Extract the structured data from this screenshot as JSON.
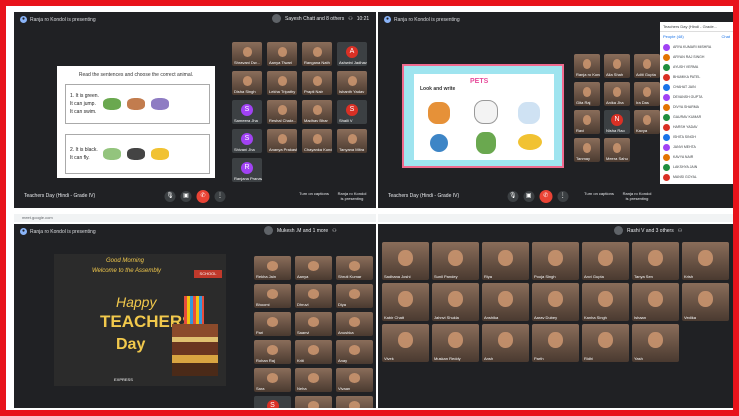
{
  "q1": {
    "presenting": "Ranja ro Kondol is presenting",
    "top_right": {
      "name": "Sayesh Chatt and 8 others",
      "time": "10:21"
    },
    "slide": {
      "heading": "Read the sentences and choose the correct animal.",
      "rows": [
        {
          "lines": [
            "1. It is green.",
            "It can jump.",
            "It can swim."
          ]
        },
        {
          "lines": [
            "2. It is black.",
            "It can fly."
          ]
        }
      ]
    },
    "participants": [
      "Shravani Dw...",
      "Aanya Tiwari",
      "Rangana Nath",
      "Ashwini Jadhav",
      "Disha Singh",
      "Lekha Tripathy",
      "Prapti Nair",
      "Ishanth Yadav",
      "Sameera Jha",
      "Reshal Chakr...",
      "Madhav Bhar",
      "Shaili V",
      "Shivani Jha",
      "Ananya Prakash",
      "Chayanka Kundu",
      "Tanyana Mitra",
      "Ranjana Pranav"
    ],
    "meeting_title": "Teachers Day (Hindi - Grade IV)",
    "btn_present": "Turn on captions",
    "btn_presenting": "Ranja ro Kondol is presenting",
    "url": "meet.google.com"
  },
  "q2": {
    "presenting": "Ranja ro Kondol is presenting",
    "slide": {
      "title": "PETS",
      "subtitle": "Look and write"
    },
    "panel_title": "Teachers Day (Hindi - Grade...",
    "panel_tabs": [
      "People (48)",
      "Chat"
    ],
    "people": [
      "ARYA KUMARI MISHRA",
      "ARYAN RAJ SINGH",
      "AYUSH VERMA",
      "BHUMIKA PATEL",
      "CHAHAT JAIN",
      "DEVANSH GUPTA",
      "DIVYA SHARMA",
      "GAURAV KUMAR",
      "HARSH YADAV",
      "ISHITA SINGH",
      "JANVI MEHTA",
      "KAVYA NAIR",
      "LAKSHYA JAIN",
      "MANSI GOYAL",
      "NAMAN SHARMA",
      "OJAS SINGH"
    ],
    "meeting_title": "Teachers Day (Hindi - Grade IV)",
    "btn_present": "Turn on captions",
    "btn_presenting": "Ranja ro Kondol is presenting",
    "participants": [
      "Ranja ro Kondol",
      "Alia Shah",
      "Aditi Gupta",
      "Gita Raj",
      "Anika Jha",
      "Ira Das",
      "Ravi",
      "Nisha Rao",
      "Kavya",
      "Tanmay",
      "Meera Sahu"
    ]
  },
  "q3": {
    "presenting": "Ranja ro Kondol is presenting",
    "top_right": {
      "name": "Mukesh .M and 1 more"
    },
    "slide": {
      "good_morning": "Good Morning",
      "welcome": "Welcome to the Assembly",
      "happy": "Happy",
      "teachers": "TEACHERS'",
      "day": "Day",
      "logo": "SCHOOL",
      "footer": "EXPRESS"
    },
    "participants": [
      "Rekha Jain",
      "Aanya",
      "Shruti Kumar",
      "Bhoomi",
      "Dhruvi",
      "Diya",
      "Pari",
      "Saanvi",
      "Anushka",
      "Rohan Raj",
      "Kriti",
      "Anay",
      "Sara",
      "Neha",
      "Vivaan",
      "Suraj Lakhan",
      "Shourya",
      "Samarth Bala"
    ]
  },
  "q4": {
    "top_right": {
      "name": "Rashi V and 3 others"
    },
    "participants": [
      "Sadhana Joshi",
      "Sunil Pandey",
      "Riya",
      "Pooja Singh",
      "Anvi Gupta",
      "Tanya Sen",
      "Krish",
      "Kabir Chatt",
      "Jahnvi Shukla",
      "Anshika",
      "Aarav Dubey",
      "Kanha Singh",
      "Ishaan",
      "Vedika",
      "Vivek",
      "Muskan Reddy",
      "Ansh",
      "Parth",
      "Ridhi",
      "Yash"
    ]
  }
}
